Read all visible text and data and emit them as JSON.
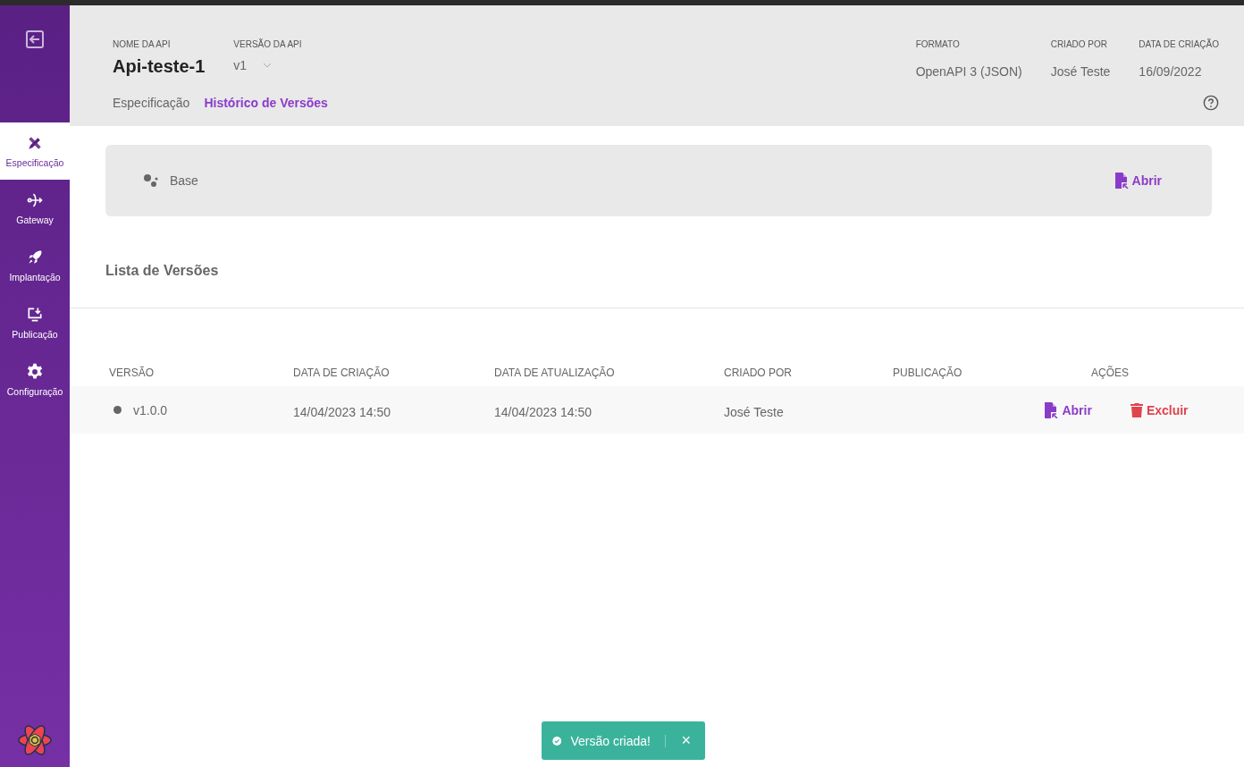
{
  "sidebar": {
    "items": [
      {
        "label": "Especificação",
        "selected": true
      },
      {
        "label": "Gateway",
        "selected": false
      },
      {
        "label": "Implantação",
        "selected": false
      },
      {
        "label": "Publicação",
        "selected": false
      },
      {
        "label": "Configuração",
        "selected": false
      }
    ]
  },
  "header": {
    "fields": [
      {
        "label": "NOME DA API",
        "value": "Api-teste-1",
        "kind": "title"
      },
      {
        "label": "VERSÃO DA API",
        "value": "v1",
        "kind": "select"
      }
    ],
    "meta": [
      {
        "label": "FORMATO",
        "value": "OpenAPI 3 (JSON)"
      },
      {
        "label": "CRIADO POR",
        "value": "José Teste"
      },
      {
        "label": "DATA DE CRIAÇÃO",
        "value": "16/09/2022"
      }
    ],
    "tabs": [
      {
        "label": "Especificação",
        "selected": false
      },
      {
        "label": "Histórico de Versões",
        "selected": true
      }
    ]
  },
  "base": {
    "label": "Base",
    "action": "Abrir"
  },
  "list_title": "Lista de Versões",
  "table": {
    "columns": [
      "VERSÃO",
      "DATA DE CRIAÇÃO",
      "DATA DE ATUALIZAÇÃO",
      "CRIADO POR",
      "PUBLICAÇÃO",
      "AÇÕES"
    ],
    "rows": [
      {
        "version": "v1.0.0",
        "created": "14/04/2023 14:50",
        "updated": "14/04/2023 14:50",
        "author": "José Teste",
        "actions": [
          {
            "kind": "open",
            "label": "Abrir"
          },
          {
            "kind": "delete",
            "label": "Excluir"
          }
        ]
      }
    ]
  },
  "toast": {
    "message": "Versão criada!",
    "close": "×"
  }
}
